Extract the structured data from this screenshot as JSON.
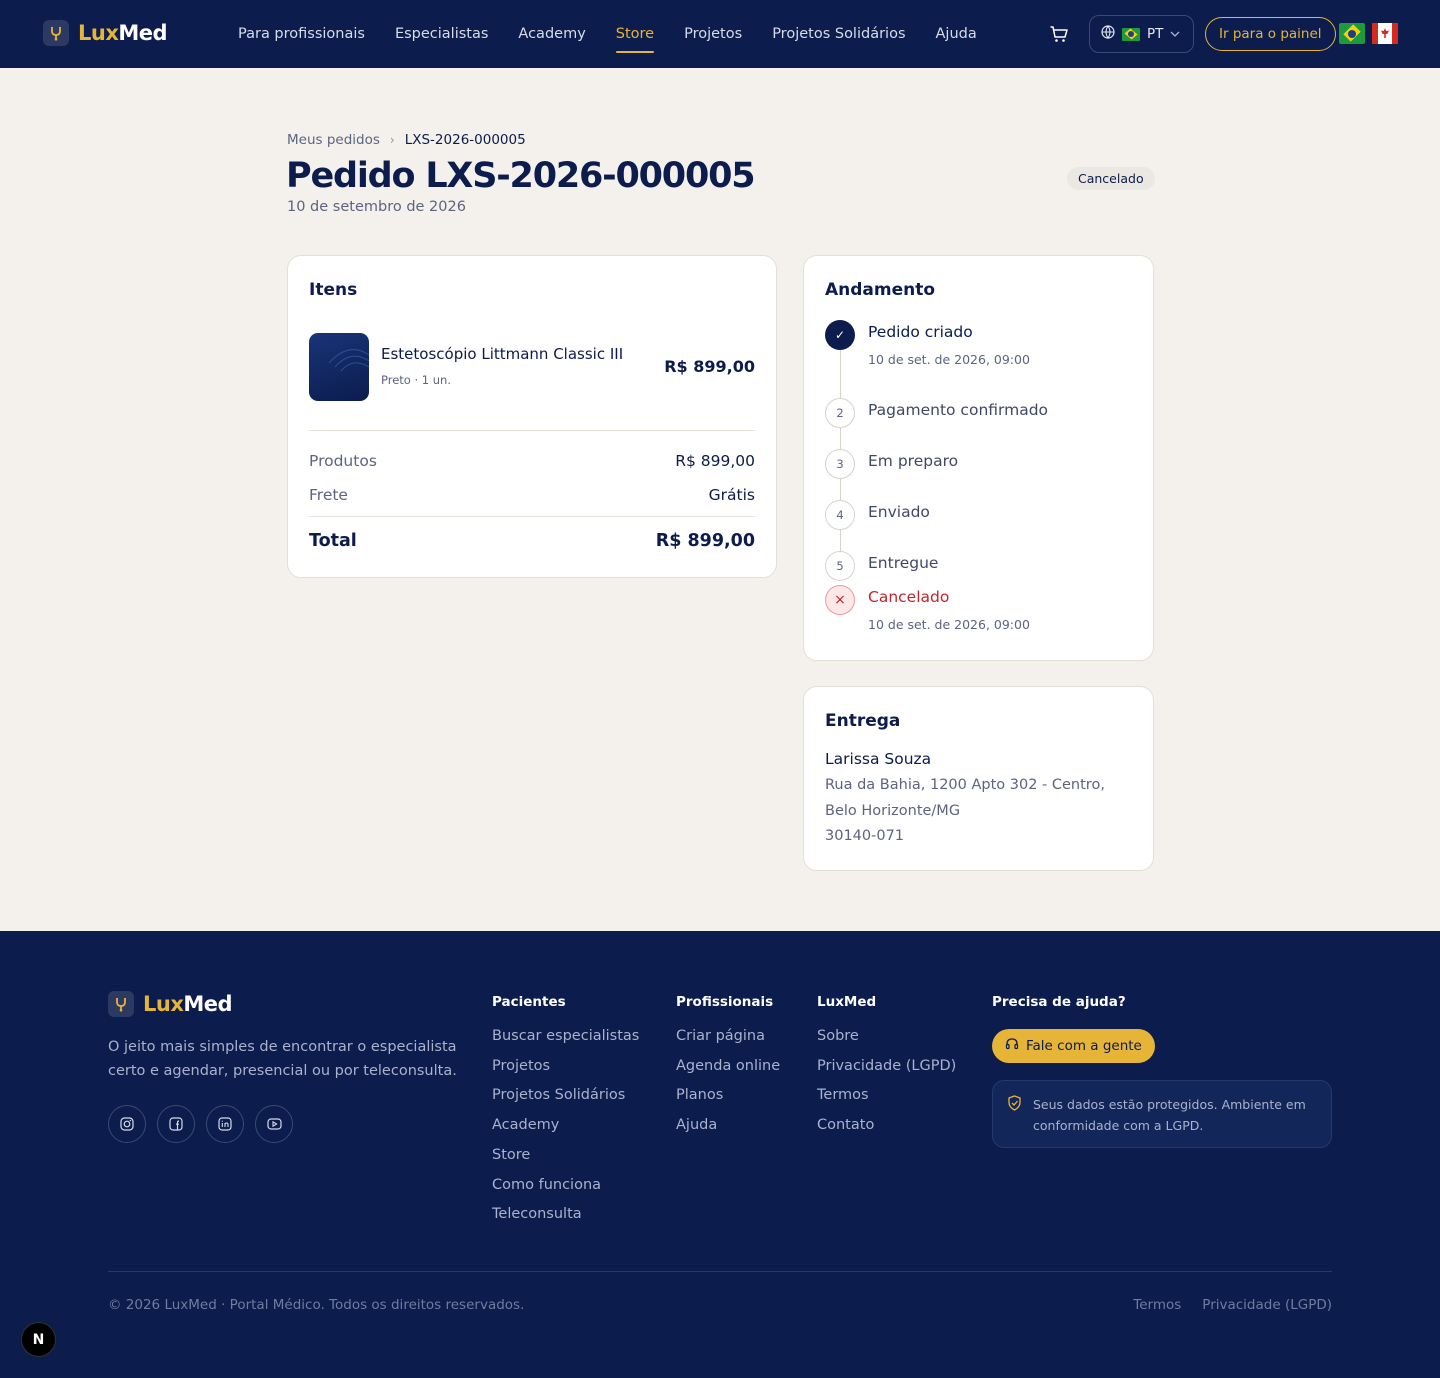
{
  "nav": {
    "brand": {
      "part1": "Lux",
      "part2": "Med"
    },
    "links": [
      {
        "label": "Para profissionais",
        "active": false
      },
      {
        "label": "Especialistas",
        "active": false
      },
      {
        "label": "Academy",
        "active": false
      },
      {
        "label": "Store",
        "active": true
      },
      {
        "label": "Projetos",
        "active": false
      },
      {
        "label": "Projetos Solidários",
        "active": false
      },
      {
        "label": "Ajuda",
        "active": false
      }
    ],
    "cart_icon": "cart-icon",
    "language": "PT",
    "panel_button": "Ir para o painel"
  },
  "breadcrumb": {
    "parent": "Meus pedidos",
    "current": "LXS-2026-000005"
  },
  "order": {
    "title": "Pedido LXS-2026-000005",
    "date": "10 de setembro de 2026",
    "status": "Cancelado"
  },
  "items_card": {
    "title": "Itens",
    "items": [
      {
        "name": "Estetoscópio Littmann Classic III",
        "meta": "Preto · 1 un.",
        "price": "R$ 899,00"
      }
    ],
    "summary": {
      "products_label": "Produtos",
      "products_value": "R$ 899,00",
      "shipping_label": "Frete",
      "shipping_value": "Grátis",
      "total_label": "Total",
      "total_value": "R$ 899,00"
    }
  },
  "progress_card": {
    "title": "Andamento",
    "steps": [
      {
        "marker": "✓",
        "label": "Pedido criado",
        "time": "10 de set. de 2026, 09:00",
        "state": "done"
      },
      {
        "marker": "2",
        "label": "Pagamento confirmado",
        "time": "",
        "state": "pending"
      },
      {
        "marker": "3",
        "label": "Em preparo",
        "time": "",
        "state": "pending"
      },
      {
        "marker": "4",
        "label": "Enviado",
        "time": "",
        "state": "pending"
      },
      {
        "marker": "5",
        "label": "Entregue",
        "time": "",
        "state": "pending"
      },
      {
        "marker": "×",
        "label": "Cancelado",
        "time": "10 de set. de 2026, 09:00",
        "state": "cancelled"
      }
    ]
  },
  "delivery_card": {
    "title": "Entrega",
    "name": "Larissa Souza",
    "address": "Rua da Bahia, 1200 Apto 302 - Centro, Belo Horizonte/MG",
    "zip": "30140-071"
  },
  "footer": {
    "tagline": "O jeito mais simples de encontrar o especialista certo e agendar, presencial ou por teleconsulta.",
    "socials": [
      "instagram-icon",
      "facebook-icon",
      "linkedin-icon",
      "youtube-icon"
    ],
    "columns": [
      {
        "title": "Pacientes",
        "links": [
          "Buscar especialistas",
          "Projetos",
          "Projetos Solidários",
          "Academy",
          "Store",
          "Como funciona",
          "Teleconsulta"
        ]
      },
      {
        "title": "Profissionais",
        "links": [
          "Criar página",
          "Agenda online",
          "Planos",
          "Ajuda"
        ]
      },
      {
        "title": "LuxMed",
        "links": [
          "Sobre",
          "Privacidade (LGPD)",
          "Termos",
          "Contato"
        ]
      }
    ],
    "help": {
      "title": "Precisa de ajuda?",
      "button": "Fale com a gente",
      "secure_text": "Seus dados estão protegidos. Ambiente em conformidade com a LGPD."
    },
    "copyright": "© 2026 LuxMed · Portal Médico. Todos os direitos reservados.",
    "bottom_links": [
      "Termos",
      "Privacidade (LGPD)"
    ]
  },
  "dev_badge": "N",
  "colors": {
    "navy": "#0b1c4d",
    "gold": "#e6b436",
    "cancel_red": "#c0262d",
    "background": "#f4f1ec"
  }
}
